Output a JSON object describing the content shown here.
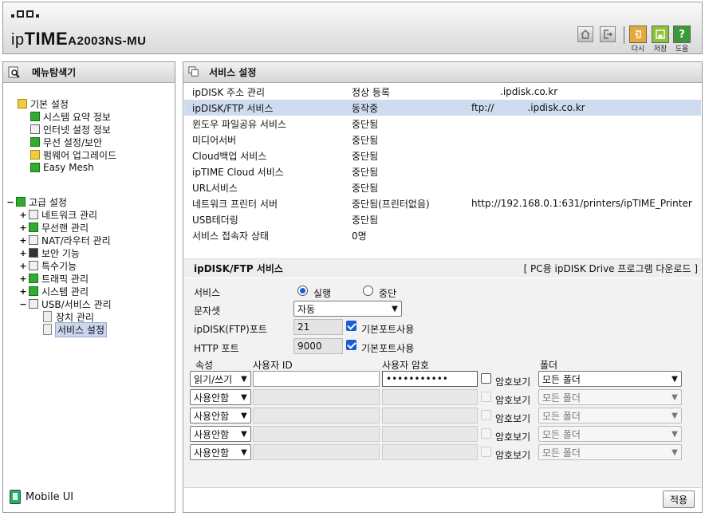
{
  "header": {
    "brand_prefix": "ip",
    "brand_bold": "TIME",
    "model": "A2003NS-MU",
    "buttons": {
      "home": "",
      "logout": "",
      "restart": "다시",
      "save": "저장",
      "help": "도움"
    },
    "help_glyph": "?"
  },
  "left": {
    "title": "메뉴탐색기",
    "basic": {
      "label": "기본 설정",
      "items": [
        "시스템 요약 정보",
        "인터넷 설정 정보",
        "무선 설정/보안",
        "펌웨어 업그레이드",
        "Easy Mesh"
      ]
    },
    "advanced": {
      "label": "고급 설정",
      "items": [
        "네트워크 관리",
        "무선랜 관리",
        "NAT/라우터 관리",
        "보안 기능",
        "특수기능",
        "트래픽 관리",
        "시스템 관리",
        "USB/서비스 관리"
      ],
      "usb_children": [
        "장치 관리",
        "서비스 설정"
      ]
    },
    "mobile": "Mobile UI"
  },
  "right": {
    "title": "서비스 설정",
    "services": [
      {
        "name": "ipDISK 주소 관리",
        "status": "정상 등록",
        "info": ".ipdisk.co.kr"
      },
      {
        "name": "ipDISK/FTP 서비스",
        "status": "동작중",
        "info": "ftp://           .ipdisk.co.kr"
      },
      {
        "name": "윈도우 파일공유 서비스",
        "status": "중단됨",
        "info": ""
      },
      {
        "name": "미디어서버",
        "status": "중단됨",
        "info": ""
      },
      {
        "name": "Cloud백업 서비스",
        "status": "중단됨",
        "info": ""
      },
      {
        "name": "ipTIME Cloud 서비스",
        "status": "중단됨",
        "info": ""
      },
      {
        "name": "URL서비스",
        "status": "중단됨",
        "info": ""
      },
      {
        "name": "네트워크 프린터 서버",
        "status": "중단됨(프린터없음)",
        "info": "http://192.168.0.1:631/printers/ipTIME_Printer"
      },
      {
        "name": "USB테더링",
        "status": "중단됨",
        "info": ""
      },
      {
        "name": "서비스 접속자 상태",
        "status": "0명",
        "info": ""
      }
    ],
    "section_title": "ipDISK/FTP 서비스",
    "download_link": "[ PC용 ipDISK Drive 프로그램 다운로드 ]",
    "form": {
      "service_label": "서비스",
      "run_label": "실행",
      "stop_label": "중단",
      "charset_label": "문자셋",
      "charset_value": "자동",
      "ftp_port_label": "ipDISK(FTP)포트",
      "ftp_port_value": "21",
      "default_port_label": "기본포트사용",
      "http_port_label": "HTTP 포트",
      "http_port_value": "9000",
      "col_attr": "속성",
      "col_user": "사용자 ID",
      "col_pass": "사용자 암호",
      "col_folder": "폴더",
      "show_pw": "암호보기",
      "accounts": [
        {
          "attr": "읽기/쓰기",
          "user": "",
          "pass": "•••••••••••",
          "folder": "모든 폴더",
          "enabled": true
        },
        {
          "attr": "사용안함",
          "user": "",
          "pass": "",
          "folder": "모든 폴더",
          "enabled": false
        },
        {
          "attr": "사용안함",
          "user": "",
          "pass": "",
          "folder": "모든 폴더",
          "enabled": false
        },
        {
          "attr": "사용안함",
          "user": "",
          "pass": "",
          "folder": "모든 폴더",
          "enabled": false
        },
        {
          "attr": "사용안함",
          "user": "",
          "pass": "",
          "folder": "모든 폴더",
          "enabled": false
        }
      ]
    },
    "apply": "적용"
  },
  "colors": {
    "highlight_row": "#cfdcef",
    "form_bg": "#f2f2f2",
    "accent": "#1a5fd1"
  }
}
